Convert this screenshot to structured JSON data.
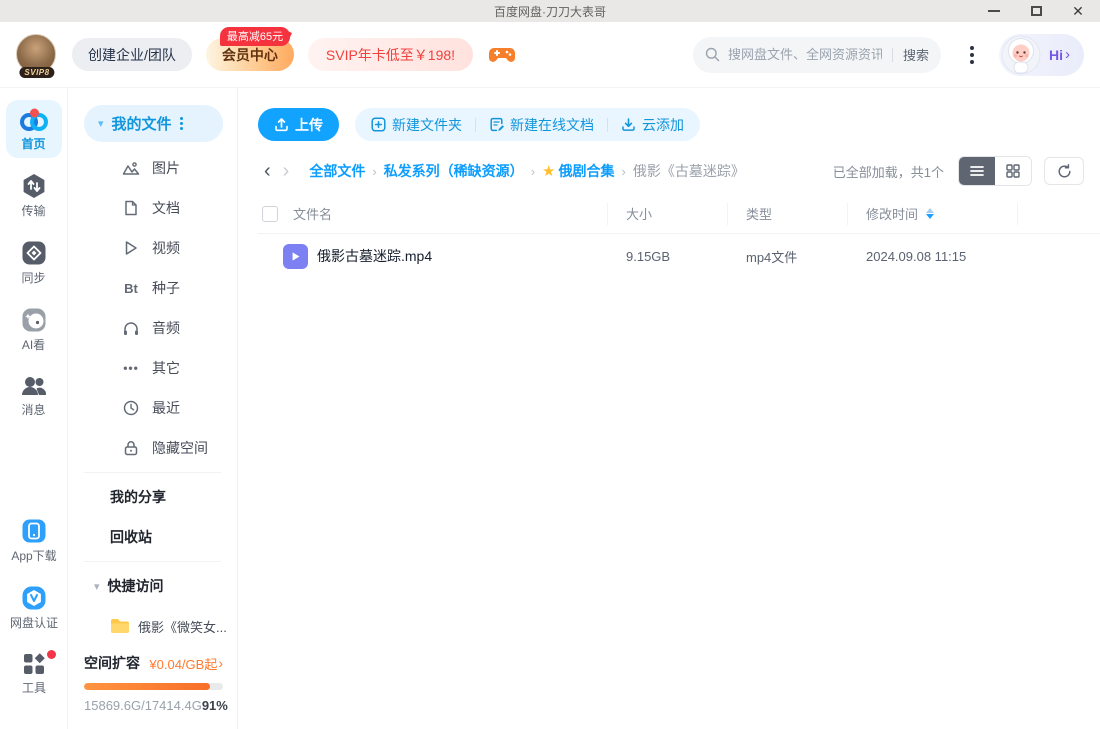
{
  "window": {
    "title": "百度网盘·刀刀大表哥"
  },
  "icons": {
    "close": "✕",
    "back": "‹",
    "forward": "›",
    "sep": "›",
    "star": "★",
    "bt": "Bt",
    "dots": "•••",
    "caret_down": "▾",
    "chevron_right": "›"
  },
  "header": {
    "logo_badge": "SVIP8",
    "create_team": "创建企业/团队",
    "member_center": "会员中心",
    "member_badge": "最高减65元",
    "svip_promo": "SVIP年卡低至￥198!",
    "search": {
      "placeholder": "搜网盘文件、全网资源资讯",
      "button": "搜索"
    },
    "greeting": "Hi"
  },
  "rail": {
    "items": [
      {
        "label": "首页"
      },
      {
        "label": "传输"
      },
      {
        "label": "同步"
      },
      {
        "label": "AI看"
      },
      {
        "label": "消息"
      }
    ],
    "bottom_items": [
      {
        "label": "App下载"
      },
      {
        "label": "网盘认证"
      },
      {
        "label": "工具"
      }
    ]
  },
  "sidebar": {
    "my_files": "我的文件",
    "categories": [
      {
        "label": "图片"
      },
      {
        "label": "文档"
      },
      {
        "label": "视频"
      },
      {
        "label": "种子"
      },
      {
        "label": "音频"
      },
      {
        "label": "其它"
      },
      {
        "label": "最近"
      },
      {
        "label": "隐藏空间"
      }
    ],
    "my_share": "我的分享",
    "recycle_bin": "回收站",
    "quick_access": "快捷访问",
    "quick_items": [
      {
        "label": "俄影《微笑女..."
      }
    ],
    "storage": {
      "expand_label": "空间扩容",
      "price": "¥0.04/GB起",
      "usage": "15869.6G/17414.4G",
      "percent": "91%",
      "percent_value": 91
    }
  },
  "toolbar": {
    "upload": "上传",
    "new_folder": "新建文件夹",
    "new_online_doc": "新建在线文档",
    "cloud_add": "云添加"
  },
  "breadcrumb": {
    "items": [
      "全部文件",
      "私发系列（稀缺资源）",
      "俄剧合集",
      "俄影《古墓迷踪》"
    ]
  },
  "listbar": {
    "status": "已全部加载，共1个"
  },
  "table": {
    "columns": [
      "文件名",
      "大小",
      "类型",
      "修改时间"
    ],
    "rows": [
      {
        "name": "俄影古墓迷踪.mp4",
        "size": "9.15GB",
        "type": "mp4文件",
        "modified": "2024.09.08 11:15"
      }
    ]
  },
  "colors": {
    "accent_blue": "#0c9dff",
    "upload_button": "#12a3ff",
    "vip_badge_red": "#f5333f",
    "promo_text_red": "#f0413c",
    "orange": "#ff7a2e",
    "folder_yellow": "#ffc848",
    "video_icon_purple": "#7c80f2",
    "star_yellow": "#ffbe2d"
  }
}
